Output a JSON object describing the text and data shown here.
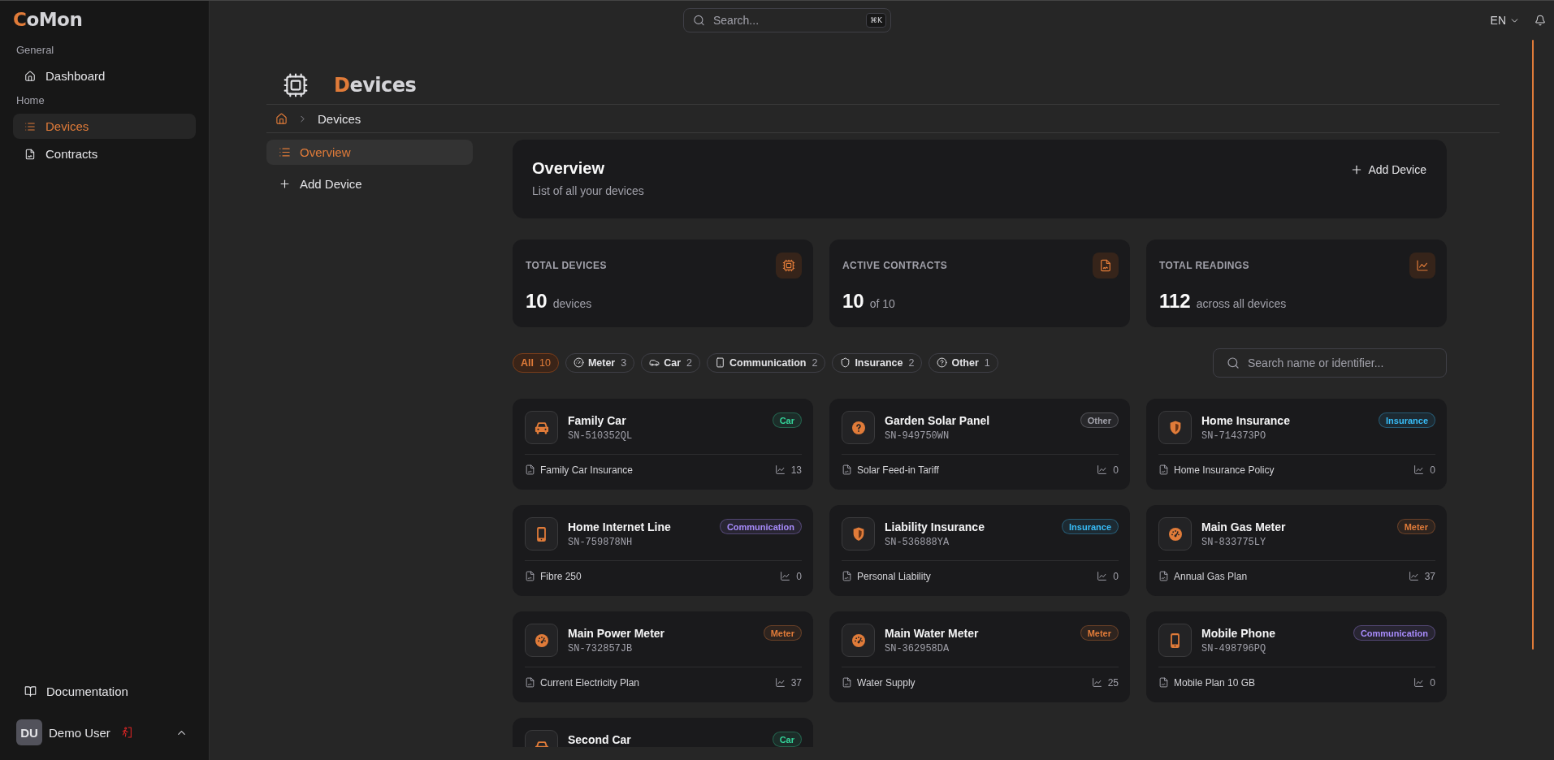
{
  "sidebar": {
    "logo": "CoMon",
    "sections": [
      {
        "label": "General",
        "items": [
          {
            "label": "Dashboard",
            "kind": "dashboard",
            "selected": false
          }
        ]
      },
      {
        "label": "Home",
        "items": [
          {
            "label": "Devices",
            "kind": "devices",
            "selected": true
          },
          {
            "label": "Contracts",
            "kind": "contracts",
            "selected": false
          }
        ]
      }
    ],
    "footer_link": "Documentation",
    "user": {
      "initials": "DU",
      "name": "Demo User"
    }
  },
  "header": {
    "search": {
      "placeholder": "Search...",
      "shortcut": "⌘K"
    },
    "language": "EN"
  },
  "page": {
    "title": "Devices",
    "breadcrumb": [
      "Devices"
    ]
  },
  "subnav": [
    {
      "label": "Overview",
      "kind": "overview",
      "selected": true
    },
    {
      "label": "Add Device",
      "kind": "add",
      "selected": false
    }
  ],
  "overview": {
    "title": "Overview",
    "subtitle": "List of all your devices",
    "action": "Add Device"
  },
  "stats": [
    {
      "label": "TOTAL DEVICES",
      "value": "10",
      "unit": "devices",
      "kind": "devices"
    },
    {
      "label": "ACTIVE CONTRACTS",
      "value": "10",
      "unit": "of 10",
      "kind": "contracts"
    },
    {
      "label": "TOTAL READINGS",
      "value": "112",
      "unit": "across all devices",
      "kind": "readings"
    }
  ],
  "filters": {
    "chips": [
      {
        "label": "All",
        "count": "10",
        "kind": "all",
        "selected": true
      },
      {
        "label": "Meter",
        "count": "3",
        "kind": "meter",
        "selected": false
      },
      {
        "label": "Car",
        "count": "2",
        "kind": "car",
        "selected": false
      },
      {
        "label": "Communication",
        "count": "2",
        "kind": "communication",
        "selected": false
      },
      {
        "label": "Insurance",
        "count": "2",
        "kind": "insurance",
        "selected": false
      },
      {
        "label": "Other",
        "count": "1",
        "kind": "other",
        "selected": false
      }
    ],
    "search": {
      "placeholder": "Search name or identifier..."
    }
  },
  "devices": [
    {
      "name": "Family Car",
      "serial": "SN-510352QL",
      "kind": "car",
      "tag": {
        "label": "Car",
        "color": "#34d399"
      },
      "contract": "Family Car Insurance",
      "readings": "13"
    },
    {
      "name": "Garden Solar Panel",
      "serial": "SN-949750WN",
      "kind": "other",
      "tag": {
        "label": "Other",
        "color": "#a1a1aa"
      },
      "contract": "Solar Feed-in Tariff",
      "readings": "0"
    },
    {
      "name": "Home Insurance",
      "serial": "SN-714373PO",
      "kind": "insurance",
      "tag": {
        "label": "Insurance",
        "color": "#38bdf8"
      },
      "contract": "Home Insurance Policy",
      "readings": "0"
    },
    {
      "name": "Home Internet Line",
      "serial": "SN-759878NH",
      "kind": "communication",
      "tag": {
        "label": "Communication",
        "color": "#a78bfa"
      },
      "contract": "Fibre 250",
      "readings": "0"
    },
    {
      "name": "Liability Insurance",
      "serial": "SN-536888YA",
      "kind": "insurance",
      "tag": {
        "label": "Insurance",
        "color": "#38bdf8"
      },
      "contract": "Personal Liability",
      "readings": "0"
    },
    {
      "name": "Main Gas Meter",
      "serial": "SN-833775LY",
      "kind": "meter",
      "tag": {
        "label": "Meter",
        "color": "#e07b39"
      },
      "contract": "Annual Gas Plan",
      "readings": "37"
    },
    {
      "name": "Main Power Meter",
      "serial": "SN-732857JB",
      "kind": "meter",
      "tag": {
        "label": "Meter",
        "color": "#e07b39"
      },
      "contract": "Current Electricity Plan",
      "readings": "37"
    },
    {
      "name": "Main Water Meter",
      "serial": "SN-362958DA",
      "kind": "meter",
      "tag": {
        "label": "Meter",
        "color": "#e07b39"
      },
      "contract": "Water Supply",
      "readings": "25"
    },
    {
      "name": "Mobile Phone",
      "serial": "SN-498796PQ",
      "kind": "communication",
      "tag": {
        "label": "Communication",
        "color": "#a78bfa"
      },
      "contract": "Mobile Plan 10 GB",
      "readings": "0"
    },
    {
      "name": "Second Car",
      "kind": "car",
      "tag": {
        "label": "Car",
        "color": "#34d399"
      }
    }
  ]
}
